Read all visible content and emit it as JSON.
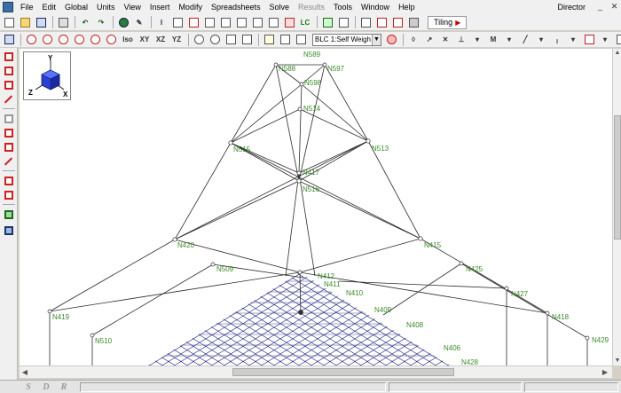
{
  "menu": {
    "items": [
      "File",
      "Edit",
      "Global",
      "Units",
      "View",
      "Insert",
      "Modify",
      "Spreadsheets",
      "Solve",
      "Results",
      "Tools",
      "Window",
      "Help"
    ],
    "disabled": [
      "Results"
    ],
    "director": "Director"
  },
  "toolbar1": {
    "lc_label": "LC",
    "tiling_label": "Tiling"
  },
  "toolbar2": {
    "view_labels": [
      "Iso",
      "XY",
      "XZ",
      "YZ"
    ],
    "load_combo": "BLC 1:Self Weigh"
  },
  "nav_cube": {
    "axis_y": "Y",
    "axis_x": "X",
    "axis_z": "Z"
  },
  "status_bar": {
    "buttons": [
      "S",
      "D",
      "R"
    ]
  },
  "model": {
    "labeled_nodes": [
      "N589",
      "N588",
      "N597",
      "N598",
      "N514",
      "N515",
      "N513",
      "N417",
      "N516",
      "N420",
      "N415",
      "N509",
      "N425",
      "N427",
      "N419",
      "N418",
      "N510",
      "N412",
      "N411",
      "N410",
      "N409",
      "N408",
      "N406",
      "N428",
      "N429"
    ],
    "colors": {
      "frame_line": "#2b2b2b",
      "grid_line": "#1a1f7a",
      "node_label": "#3c8a2a",
      "background": "#ffffff"
    }
  }
}
